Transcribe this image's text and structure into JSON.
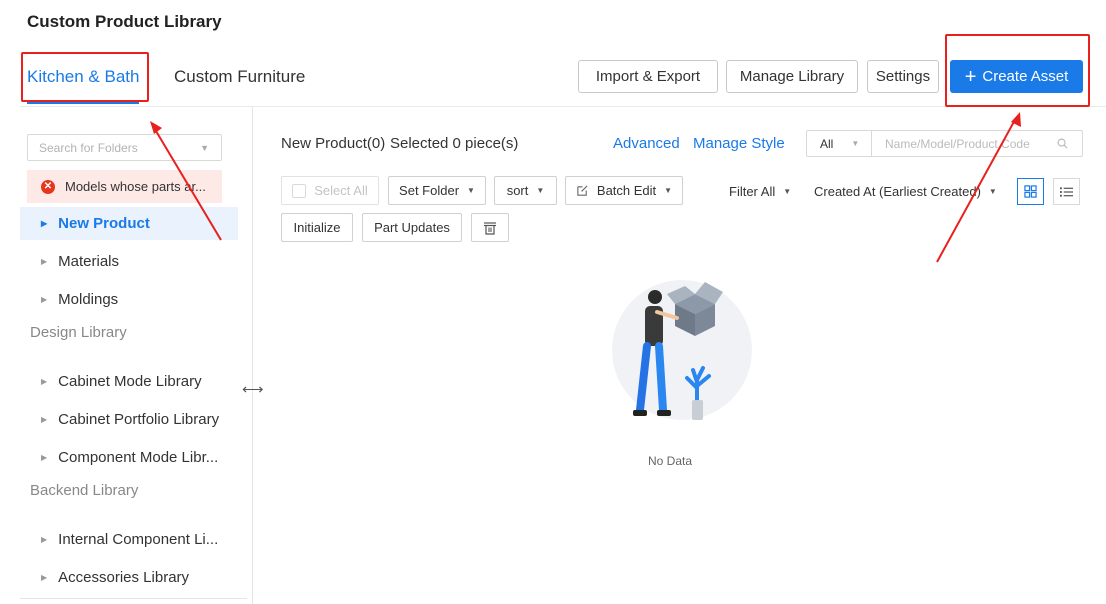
{
  "page_title": "Custom Product Library",
  "tabs": [
    {
      "label": "Kitchen & Bath",
      "active": true
    },
    {
      "label": "Custom Furniture",
      "active": false
    }
  ],
  "header_buttons": {
    "import_export": "Import & Export",
    "manage_library": "Manage Library",
    "settings": "Settings",
    "create_asset": "Create Asset"
  },
  "sidebar": {
    "search_placeholder": "Search for Folders",
    "warning_item": "Models whose parts ar...",
    "items": [
      {
        "label": "New Product",
        "active": true
      },
      {
        "label": "Materials"
      },
      {
        "label": "Moldings"
      }
    ],
    "sections": [
      {
        "title": "Design Library",
        "items": [
          "Cabinet Mode Library",
          "Cabinet Portfolio Library",
          "Component Mode Libr..."
        ]
      },
      {
        "title": "Backend Library",
        "items": [
          "Internal Component Li...",
          "Accessories Library"
        ]
      }
    ]
  },
  "main": {
    "title": "New Product(0)",
    "selected_text": "Selected 0 piece(s)",
    "advanced_link": "Advanced",
    "manage_style_link": "Manage Style",
    "scope_select": "All",
    "code_search_placeholder": "Name/Model/Product Code",
    "toolbar": {
      "select_all": "Select All",
      "set_folder": "Set Folder",
      "sort": "sort",
      "batch_edit": "Batch Edit",
      "filter": "Filter All",
      "order": "Created At (Earliest Created)",
      "initialize": "Initialize",
      "part_updates": "Part Updates"
    },
    "empty_text": "No Data"
  },
  "colors": {
    "accent": "#1a7ae8",
    "annotation": "#e8201e",
    "warning_bg": "#fde9e6"
  }
}
